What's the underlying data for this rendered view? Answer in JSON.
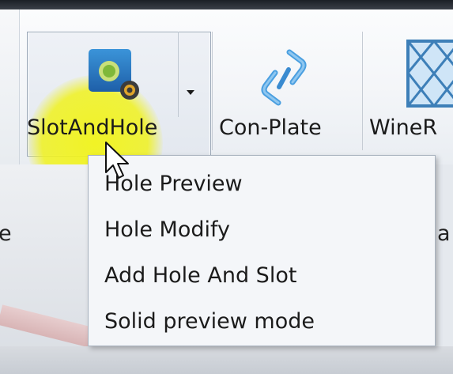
{
  "ribbon": {
    "buttons": [
      {
        "label": "SlotAndHole",
        "icon": "slot-and-hole-icon",
        "pressed": true,
        "has_dropdown": true
      },
      {
        "label": "Con-Plate",
        "icon": "chain-link-icon"
      },
      {
        "label": "WineR",
        "icon": "wine-rack-icon"
      }
    ]
  },
  "menu": {
    "items": [
      {
        "label": "Hole Preview"
      },
      {
        "label": "Hole Modify"
      },
      {
        "label": "Add Hole And Slot"
      },
      {
        "label": "Solid preview mode"
      }
    ]
  },
  "workspace": {
    "left_fragment": "e",
    "right_fragment": "a"
  },
  "colors": {
    "highlight": "#f2f414",
    "menu_bg": "#f4f6f9",
    "icon_blue": "#2f7fc8"
  }
}
